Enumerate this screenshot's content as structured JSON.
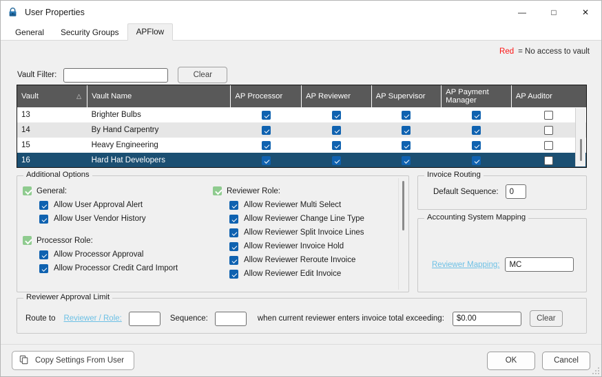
{
  "window": {
    "title": "User Properties",
    "icon": "lock-icon",
    "controls": {
      "minimize": "—",
      "maximize": "□",
      "close": "✕"
    }
  },
  "tabs": [
    {
      "label": "General",
      "active": false
    },
    {
      "label": "Security Groups",
      "active": false
    },
    {
      "label": "APFlow",
      "active": true
    }
  ],
  "legend": {
    "red_word": "Red",
    "text": "= No access to vault",
    "red_color": "#fc1313"
  },
  "filter": {
    "label": "Vault Filter:",
    "value": "",
    "placeholder": "",
    "clear_label": "Clear"
  },
  "grid": {
    "columns": [
      {
        "label": "Vault",
        "sorted": true,
        "sort_arrow": "△"
      },
      {
        "label": "Vault Name"
      },
      {
        "label": "AP Processor"
      },
      {
        "label": "AP Reviewer"
      },
      {
        "label": "AP Supervisor"
      },
      {
        "label": "AP Payment Manager"
      },
      {
        "label": "AP Auditor"
      }
    ],
    "rows": [
      {
        "id": "13",
        "name": "Brighter Bulbs",
        "processor": true,
        "reviewer": true,
        "supervisor": true,
        "payment_manager": true,
        "auditor": false,
        "selected": false
      },
      {
        "id": "14",
        "name": "By Hand Carpentry",
        "processor": true,
        "reviewer": true,
        "supervisor": true,
        "payment_manager": true,
        "auditor": false,
        "selected": false
      },
      {
        "id": "15",
        "name": "Heavy Engineering",
        "processor": true,
        "reviewer": true,
        "supervisor": true,
        "payment_manager": true,
        "auditor": false,
        "selected": false
      },
      {
        "id": "16",
        "name": "Hard Hat Developers",
        "processor": true,
        "reviewer": true,
        "supervisor": true,
        "payment_manager": true,
        "auditor": false,
        "selected": true
      }
    ]
  },
  "additional_options": {
    "title": "Additional Options",
    "left_column": [
      {
        "header": "General:",
        "header_checked": true,
        "items": [
          {
            "label": "Allow User Approval Alert",
            "checked": true
          },
          {
            "label": "Allow User Vendor History",
            "checked": true
          }
        ]
      },
      {
        "header": "Processor Role:",
        "header_checked": true,
        "items": [
          {
            "label": "Allow Processor Approval",
            "checked": true
          },
          {
            "label": "Allow Processor Credit Card Import",
            "checked": true
          }
        ]
      }
    ],
    "right_column": [
      {
        "header": "Reviewer Role:",
        "header_checked": true,
        "items": [
          {
            "label": "Allow Reviewer Multi Select",
            "checked": true
          },
          {
            "label": "Allow Reviewer Change Line Type",
            "checked": true
          },
          {
            "label": "Allow Reviewer Split Invoice Lines",
            "checked": true
          },
          {
            "label": "Allow Reviewer Invoice Hold",
            "checked": true
          },
          {
            "label": "Allow Reviewer Reroute Invoice",
            "checked": true
          },
          {
            "label": "Allow Reviewer Edit Invoice",
            "checked": true
          }
        ]
      }
    ]
  },
  "invoice_routing": {
    "title": "Invoice Routing",
    "default_sequence_label": "Default Sequence:",
    "default_sequence_value": "0"
  },
  "accounting_mapping": {
    "title": "Accounting System Mapping",
    "reviewer_mapping_label": "Reviewer Mapping:",
    "reviewer_mapping_value": "MC"
  },
  "reviewer_limit": {
    "title": "Reviewer Approval Limit",
    "route_to_label": "Route to",
    "reviewer_role_link": "Reviewer / Role:",
    "reviewer_role_value": "",
    "sequence_label": "Sequence:",
    "sequence_value": "",
    "condition_text": "when current reviewer enters invoice total exceeding:",
    "amount_value": "$0.00",
    "clear_label": "Clear"
  },
  "footer": {
    "copy_settings_label": "Copy Settings From User",
    "copy_icon": "copy-icon",
    "ok_label": "OK",
    "cancel_label": "Cancel"
  },
  "colors": {
    "header_bg": "#595959",
    "selected_row": "#1b4f72",
    "checkbox_blue": "#0f62b0",
    "checkbox_green": "#8fcb8f",
    "link_blue": "#6cc0e5"
  }
}
